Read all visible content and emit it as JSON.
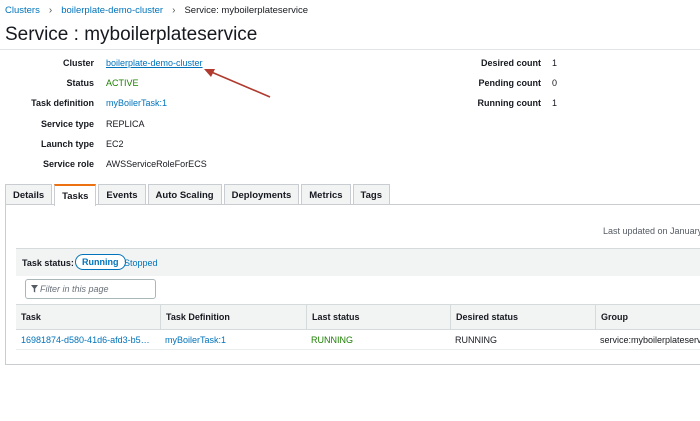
{
  "breadcrumb": {
    "items": [
      "Clusters",
      "boilerplate-demo-cluster"
    ],
    "separator": "›",
    "current": "Service: myboilerplateservice"
  },
  "page": {
    "title": "Service : myboilerplateservice"
  },
  "details_left": [
    {
      "label": "Cluster",
      "value": "boilerplate-demo-cluster"
    },
    {
      "label": "Status",
      "value": "ACTIVE"
    },
    {
      "label": "Task definition",
      "value": "myBoilerTask:1"
    },
    {
      "label": "Service type",
      "value": "REPLICA"
    },
    {
      "label": "Launch type",
      "value": "EC2"
    },
    {
      "label": "Service role",
      "value": "AWSServiceRoleForECS"
    }
  ],
  "details_right": [
    {
      "label": "Desired count",
      "value": "1"
    },
    {
      "label": "Pending count",
      "value": "0"
    },
    {
      "label": "Running count",
      "value": "1"
    }
  ],
  "tabs": [
    "Details",
    "Tasks",
    "Events",
    "Auto Scaling",
    "Deployments",
    "Metrics",
    "Tags"
  ],
  "active_tab": "Tasks",
  "tasks_panel": {
    "last_updated": "Last updated on January",
    "status_label": "Task status:",
    "status_options": [
      "Running",
      "Stopped"
    ],
    "filter_placeholder": "Filter in this page",
    "columns": [
      "Task",
      "Task Definition",
      "Last status",
      "Desired status",
      "Group"
    ],
    "rows": [
      [
        "16981874-d580-41d6-afd3-b5…",
        "myBoilerTask:1",
        "RUNNING",
        "RUNNING",
        "service:myboilerplateserv"
      ]
    ]
  },
  "colors": {
    "link": "#0073bb",
    "active_green": "#1d8102",
    "tab_accent": "#ec7211",
    "annotation_arrow": "#b03a2e"
  },
  "icons": [
    "chevron-right-icon",
    "filter-icon",
    "annotation-arrow"
  ]
}
